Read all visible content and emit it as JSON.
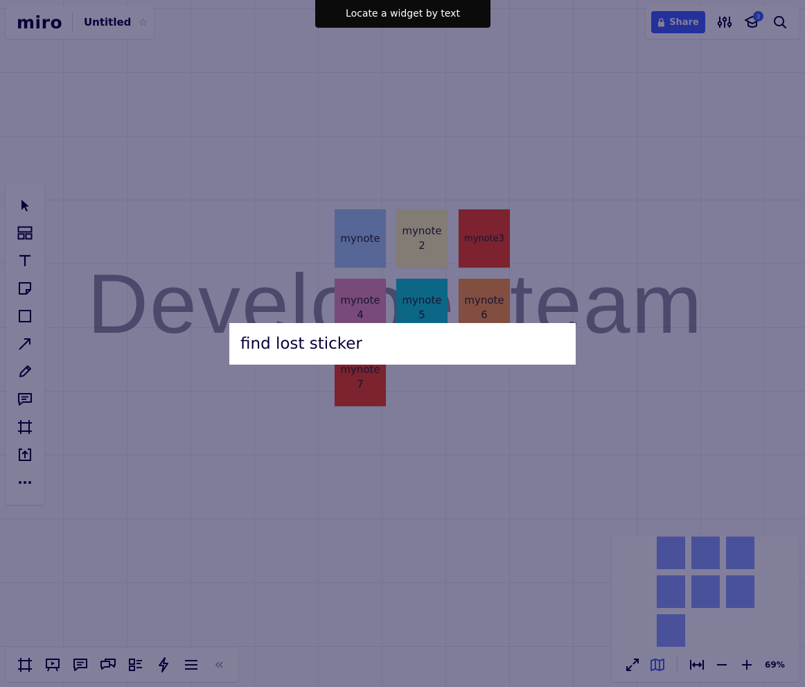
{
  "app": {
    "logo": "miro",
    "board_title": "Untitled",
    "star_icon": "star-icon"
  },
  "topbar": {
    "share_label": "Share",
    "notification_count": "3",
    "icons": [
      "lock-icon",
      "settings-sliders-icon",
      "learning-hat-icon",
      "search-icon"
    ]
  },
  "tooltip": {
    "text": "Locate a widget by text"
  },
  "board": {
    "background_text": "Developer team",
    "stickies": [
      {
        "text": "mynote",
        "color": "#a6ccf5"
      },
      {
        "text": "mynote 2",
        "color": "#fff9b1"
      },
      {
        "text": "mynote3",
        "color": "#f24726"
      },
      {
        "text": "mynote 4",
        "color": "#ea94bb"
      },
      {
        "text": "mynote 5",
        "color": "#12cdd4"
      },
      {
        "text": "mynote 6",
        "color": "#ff9d48"
      },
      {
        "text": "mynote 7",
        "color": "#f24726"
      }
    ]
  },
  "left_toolbar": {
    "items": [
      "select-cursor-icon",
      "templates-icon",
      "text-icon",
      "sticky-note-icon",
      "shape-icon",
      "connection-line-icon",
      "pen-icon",
      "comment-icon",
      "frame-icon",
      "upload-icon",
      "more-icon"
    ]
  },
  "bottom_toolbar": {
    "items": [
      "frames-icon",
      "presentation-icon",
      "comments-icon",
      "chat-icon",
      "card-icon",
      "activity-icon",
      "menu-icon",
      "collapse-icon"
    ]
  },
  "minimap": {
    "controls": [
      "fullscreen-icon",
      "map-icon",
      "fit-width-icon",
      "zoom-out-icon",
      "zoom-in-icon"
    ],
    "zoom_level": "69%"
  },
  "search": {
    "value": "find lost sticker",
    "placeholder": ""
  },
  "colors": {
    "accent": "#4262ff",
    "overlay": "#050038",
    "tooltip_bg": "#0b0b0b"
  }
}
